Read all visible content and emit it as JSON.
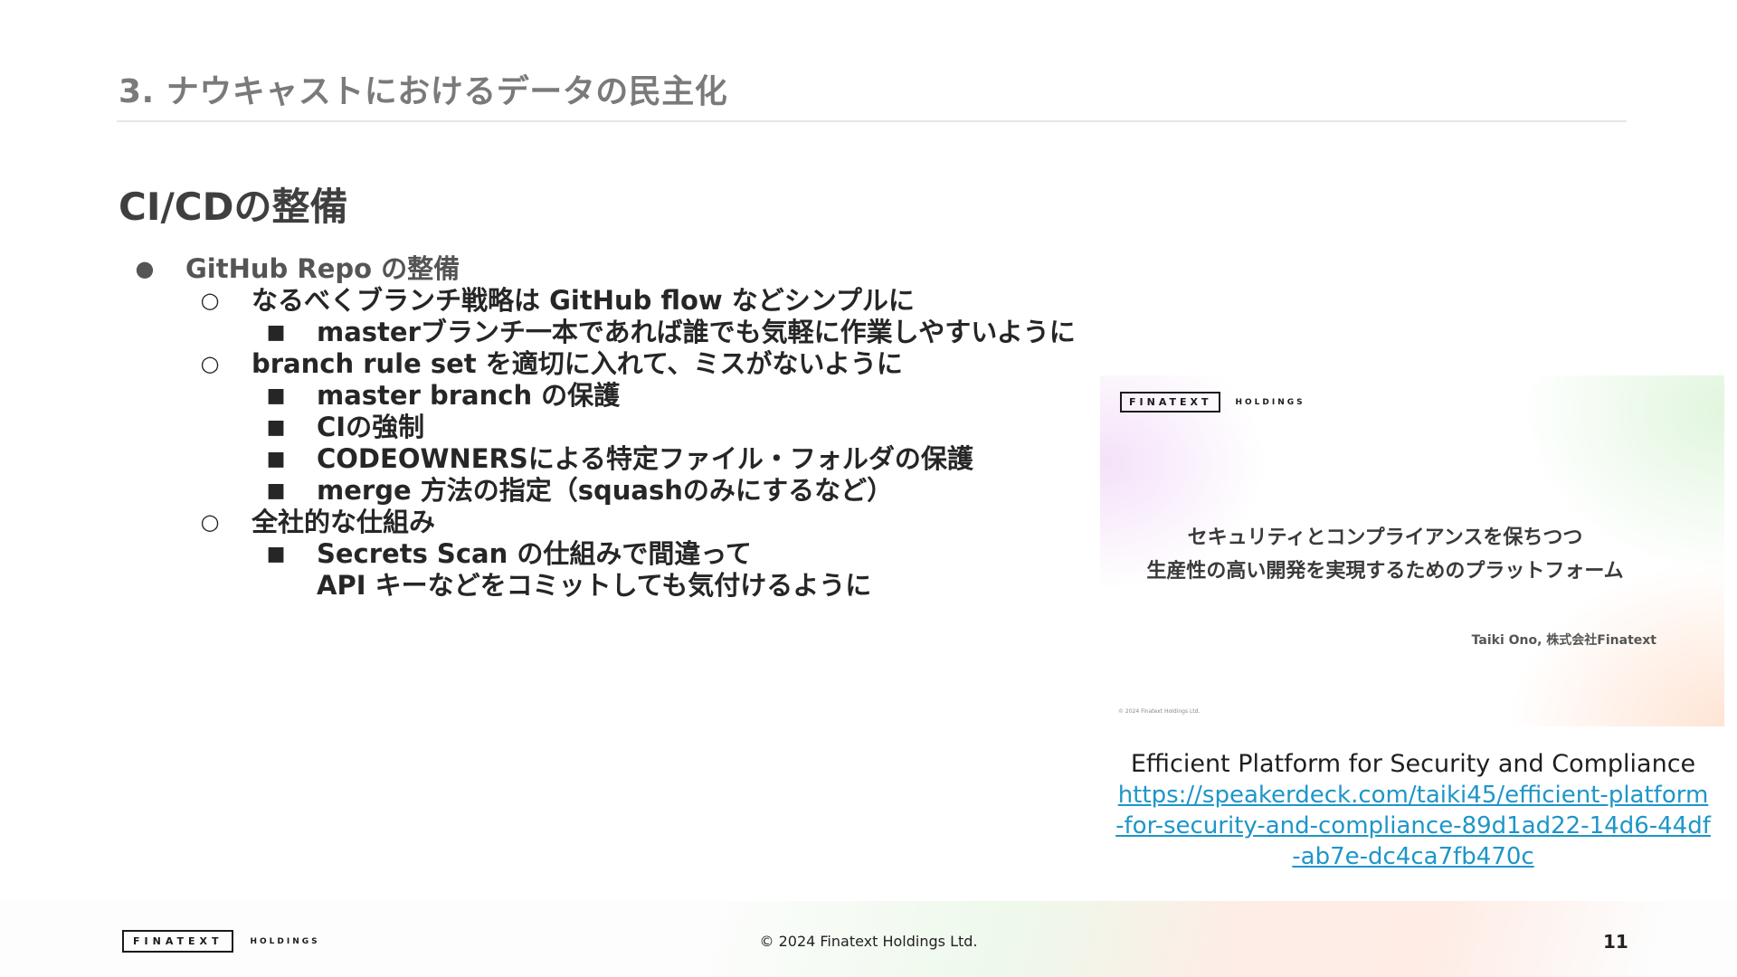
{
  "section_title": "3. ナウキャストにおけるデータの民主化",
  "heading": "CI/CDの整備",
  "bullets": [
    {
      "level": 1,
      "marker": "●",
      "text": "GitHub Repo の整備"
    },
    {
      "level": 2,
      "marker": "○",
      "text": "なるべくブランチ戦略は GitHub flow などシンプルに"
    },
    {
      "level": 3,
      "marker": "■",
      "text": "masterブランチ一本であれば誰でも気軽に作業しやすいように"
    },
    {
      "level": 2,
      "marker": "○",
      "text": "branch rule set を適切に入れて、ミスがないように"
    },
    {
      "level": 3,
      "marker": "■",
      "text": "master branch の保護"
    },
    {
      "level": 3,
      "marker": "■",
      "text": "CIの強制"
    },
    {
      "level": 3,
      "marker": "■",
      "text": "CODEOWNERSによる特定ファイル・フォルダの保護"
    },
    {
      "level": 3,
      "marker": "■",
      "text": "merge 方法の指定（squashのみにするなど）"
    },
    {
      "level": 2,
      "marker": "○",
      "text": "全社的な仕組み"
    },
    {
      "level": 3,
      "marker": "■",
      "text": "Secrets Scan の仕組みで間違って"
    },
    {
      "level": 4,
      "marker": "",
      "text": "API キーなどをコミットしても気付けるように"
    }
  ],
  "thumbnail": {
    "logo_main": "FINATEXT",
    "logo_sub": "HOLDINGS",
    "title_line1": "セキュリティとコンプライアンスを保ちつつ",
    "title_line2": "生産性の高い開発を実現するためのプラットフォーム",
    "author": "Taiki Ono, 株式会社Finatext",
    "copyright": "© 2024 Finatext Holdings Ltd."
  },
  "caption": "Efficient Platform for Security and Compliance",
  "link_url": "https://speakerdeck.com/taiki45/efficient-platform-for-security-and-compliance-89d1ad22-14d6-44df-ab7e-dc4ca7fb470c",
  "footer": {
    "logo_main": "FINATEXT",
    "logo_sub": "HOLDINGS",
    "copyright": "© 2024 Finatext Holdings Ltd.",
    "page_number": "11"
  },
  "colors": {
    "link": "#1e96c8",
    "section_title": "#7a7a7a"
  }
}
